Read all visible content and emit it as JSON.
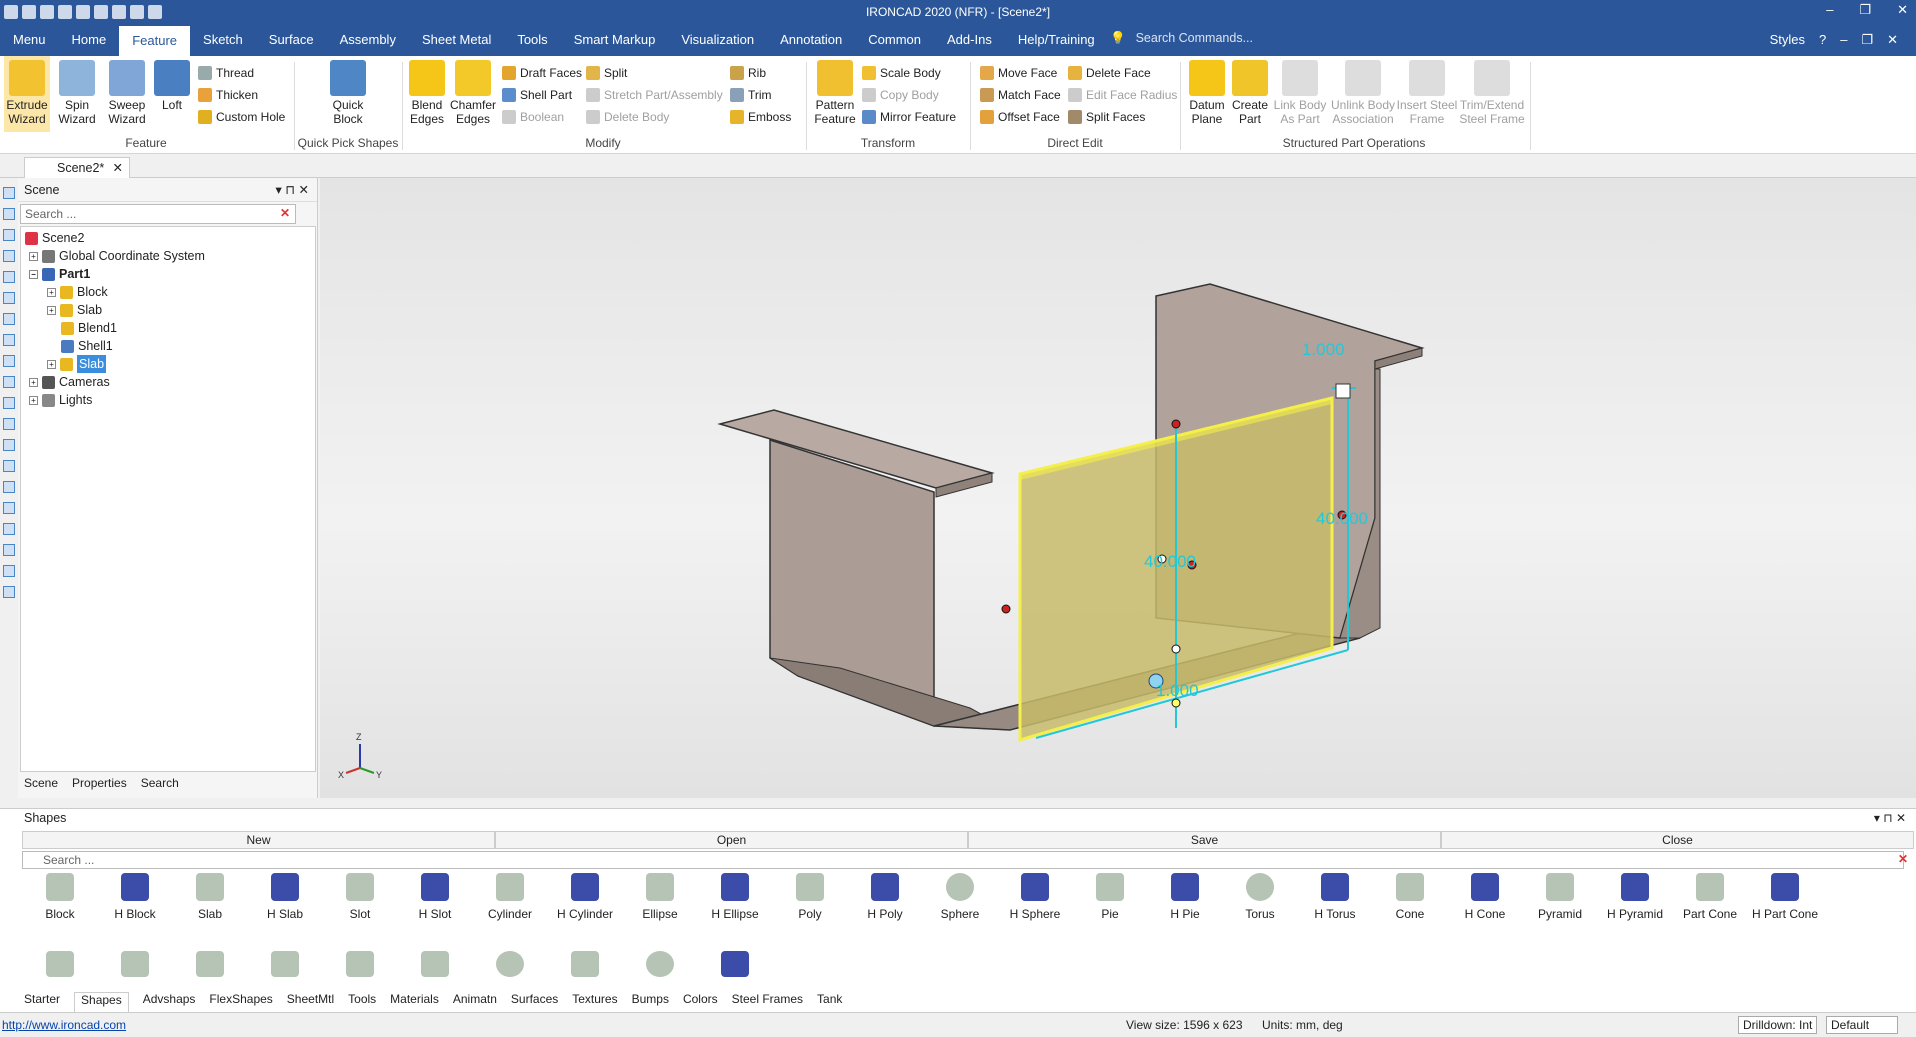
{
  "window": {
    "title": "IRONCAD 2020 (NFR) - [Scene2*]"
  },
  "menu": {
    "tabs": [
      "Menu",
      "Home",
      "Feature",
      "Sketch",
      "Surface",
      "Assembly",
      "Sheet Metal",
      "Tools",
      "Smart Markup",
      "Visualization",
      "Annotation",
      "Common",
      "Add-Ins",
      "Help/Training"
    ],
    "active": "Feature",
    "search_placeholder": "Search Commands...",
    "styles": "Styles"
  },
  "ribbon": {
    "feature": {
      "extrude": "Extrude\nWizard",
      "spin": "Spin\nWizard",
      "sweep": "Sweep\nWizard",
      "loft": "Loft",
      "thread": "Thread",
      "thicken": "Thicken",
      "custom_hole": "Custom Hole",
      "group": "Feature"
    },
    "quick": {
      "label": "Quick\nBlock",
      "group": "Quick Pick Shapes"
    },
    "modify": {
      "blend": "Blend\nEdges",
      "chamfer": "Chamfer\nEdges",
      "draft": "Draft Faces",
      "shell": "Shell Part",
      "boolean": "Boolean",
      "split": "Split",
      "stretch": "Stretch Part/Assembly",
      "delete_body": "Delete Body",
      "rib": "Rib",
      "trim": "Trim",
      "emboss": "Emboss",
      "group": "Modify"
    },
    "transform": {
      "pattern": "Pattern\nFeature",
      "scale": "Scale Body",
      "copy": "Copy Body",
      "mirror": "Mirror Feature",
      "group": "Transform"
    },
    "direct": {
      "move": "Move Face",
      "match": "Match Face",
      "offset": "Offset Face",
      "delete": "Delete Face",
      "radius": "Edit Face Radius",
      "split": "Split Faces",
      "group": "Direct Edit"
    },
    "struct": {
      "datum": "Datum\nPlane",
      "create": "Create\nPart",
      "link": "Link Body\nAs Part",
      "unlink": "Unlink Body\nAssociation",
      "insert": "Insert Steel\nFrame",
      "trimext": "Trim/Extend\nSteel Frame",
      "group": "Structured Part Operations"
    }
  },
  "doc_tab": "Scene2*",
  "scene": {
    "title": "Scene",
    "search": "Search ...",
    "tree": [
      "Scene2",
      "Global Coordinate System",
      "Part1",
      "Block",
      "Slab",
      "Blend1",
      "Shell1",
      "Slab",
      "Cameras",
      "Lights"
    ],
    "tabs": [
      "Scene",
      "Properties",
      "Search"
    ]
  },
  "viewport": {
    "dim_top": "1.000",
    "dim_right": "40.000",
    "dim_mid": "40.000",
    "dim_bottom": "1.000",
    "axis_x": "X",
    "axis_y": "Y",
    "axis_z": "Z"
  },
  "shapes": {
    "title": "Shapes",
    "buttons": [
      "New",
      "Open",
      "Save",
      "Close"
    ],
    "search": "Search ...",
    "items": [
      "Block",
      "H Block",
      "Slab",
      "H Slab",
      "Slot",
      "H Slot",
      "Cylinder",
      "H Cylinder",
      "Ellipse",
      "H Ellipse",
      "Poly",
      "H Poly",
      "Sphere",
      "H Sphere",
      "Pie",
      "H Pie",
      "Torus",
      "H Torus",
      "Cone",
      "H Cone",
      "Pyramid",
      "H Pyramid",
      "Part Cone",
      "H Part Cone"
    ],
    "tabs": [
      "Starter",
      "Shapes",
      "Advshaps",
      "FlexShapes",
      "SheetMtl",
      "Tools",
      "Materials",
      "Animatn",
      "Surfaces",
      "Textures",
      "Bumps",
      "Colors",
      "Steel Frames",
      "Tank"
    ],
    "active_tab": "Shapes"
  },
  "status": {
    "link": "http://www.ironcad.com",
    "view_size": "View size: 1596 x 623",
    "units_label": "Units:",
    "units": "mm, deg",
    "drilldown": "Drilldown: Int",
    "default": "Default"
  }
}
